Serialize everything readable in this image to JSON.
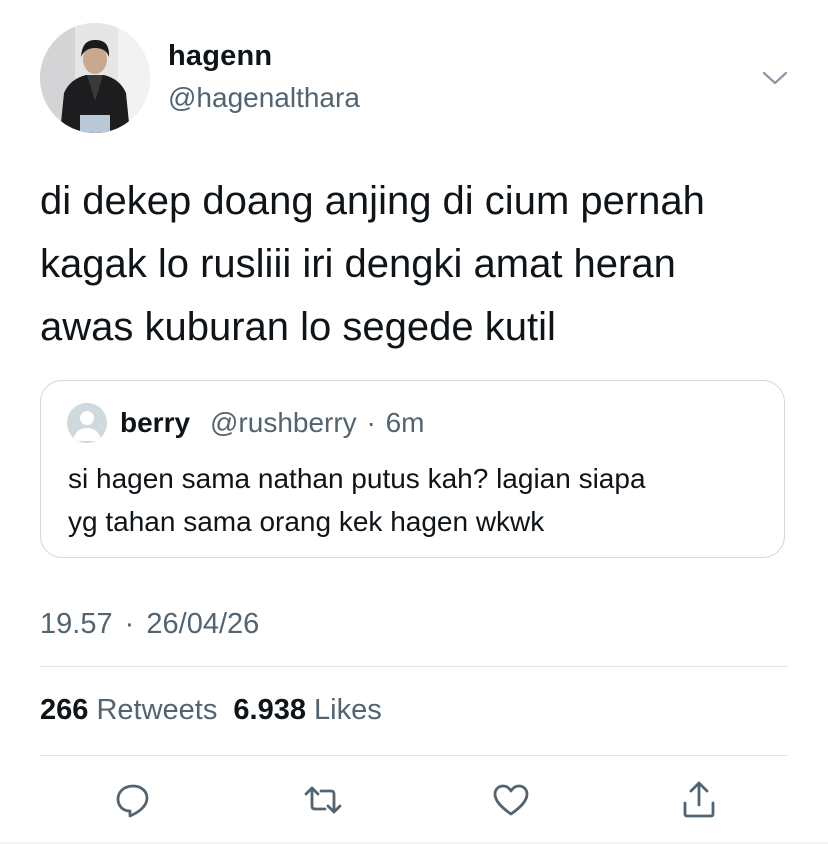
{
  "author": {
    "display_name": "hagenn",
    "handle": "@hagenalthara"
  },
  "tweet": {
    "lines": [
      "di dekep doang anjing di cium pernah",
      "kagak lo rusliii iri dengki amat heran",
      "awas kuburan lo segede kutil"
    ]
  },
  "quoted_tweet": {
    "display_name": "berry",
    "handle": "@rushberry",
    "separator": "·",
    "time": "6m",
    "lines": [
      "si hagen sama nathan putus kah? lagian siapa",
      "yg tahan sama orang kek hagen wkwk"
    ]
  },
  "meta": {
    "time": "19.57",
    "separator": "·",
    "date": "26/04/26"
  },
  "stats": {
    "retweets_count": "266",
    "retweets_label": "Retweets",
    "likes_count": "6.938",
    "likes_label": "Likes"
  },
  "icons": {
    "menu": "chevron-down-icon",
    "reply": "reply-icon",
    "retweet": "retweet-icon",
    "like": "heart-icon",
    "share": "share-icon"
  },
  "colors": {
    "text": "#0f1419",
    "secondary": "#536471",
    "border": "#cfd9de"
  }
}
